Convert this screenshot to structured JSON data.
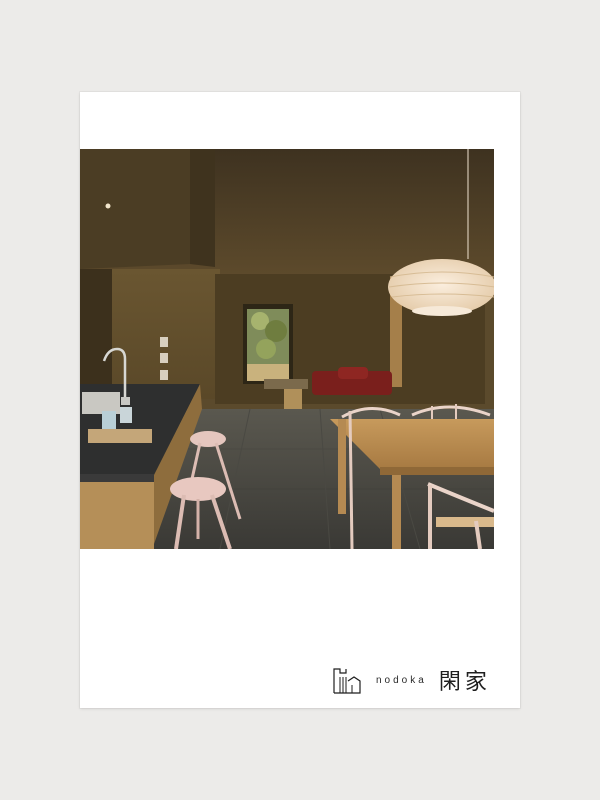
{
  "brand": {
    "roman": "nodoka",
    "kanji": "閑家",
    "logo_icon": "house-outline-icon"
  },
  "photo": {
    "subject": "interior-kitchen-dining"
  },
  "colors": {
    "background": "#ecebe9",
    "card": "#ffffff",
    "text": "#1e1e1e"
  }
}
